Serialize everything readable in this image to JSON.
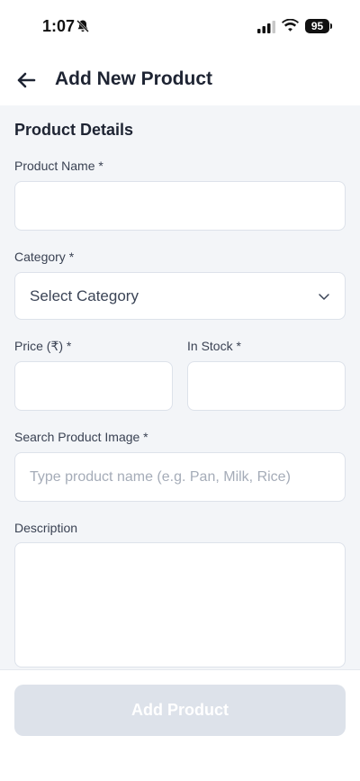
{
  "status_bar": {
    "time": "1:07",
    "battery": "95"
  },
  "header": {
    "title": "Add New Product"
  },
  "form": {
    "section_title": "Product Details",
    "product_name": {
      "label": "Product Name *",
      "value": "",
      "placeholder": ""
    },
    "category": {
      "label": "Category *",
      "selected": "Select Category"
    },
    "price": {
      "label": "Price (₹) *",
      "value": ""
    },
    "in_stock": {
      "label": "In Stock *",
      "value": ""
    },
    "image_search": {
      "label": "Search Product Image *",
      "placeholder": "Type product name (e.g. Pan, Milk, Rice)"
    },
    "description": {
      "label": "Description",
      "value": ""
    }
  },
  "footer": {
    "submit_label": "Add Product"
  },
  "colors": {
    "page_bg": "#f3f5f8",
    "field_border": "#dde2ea",
    "button_disabled": "#dde2ea",
    "text_primary": "#1e2433"
  },
  "icons": [
    "bell-slash-icon",
    "signal-icon",
    "wifi-icon",
    "battery-icon",
    "arrow-left-icon",
    "chevron-down-icon"
  ]
}
